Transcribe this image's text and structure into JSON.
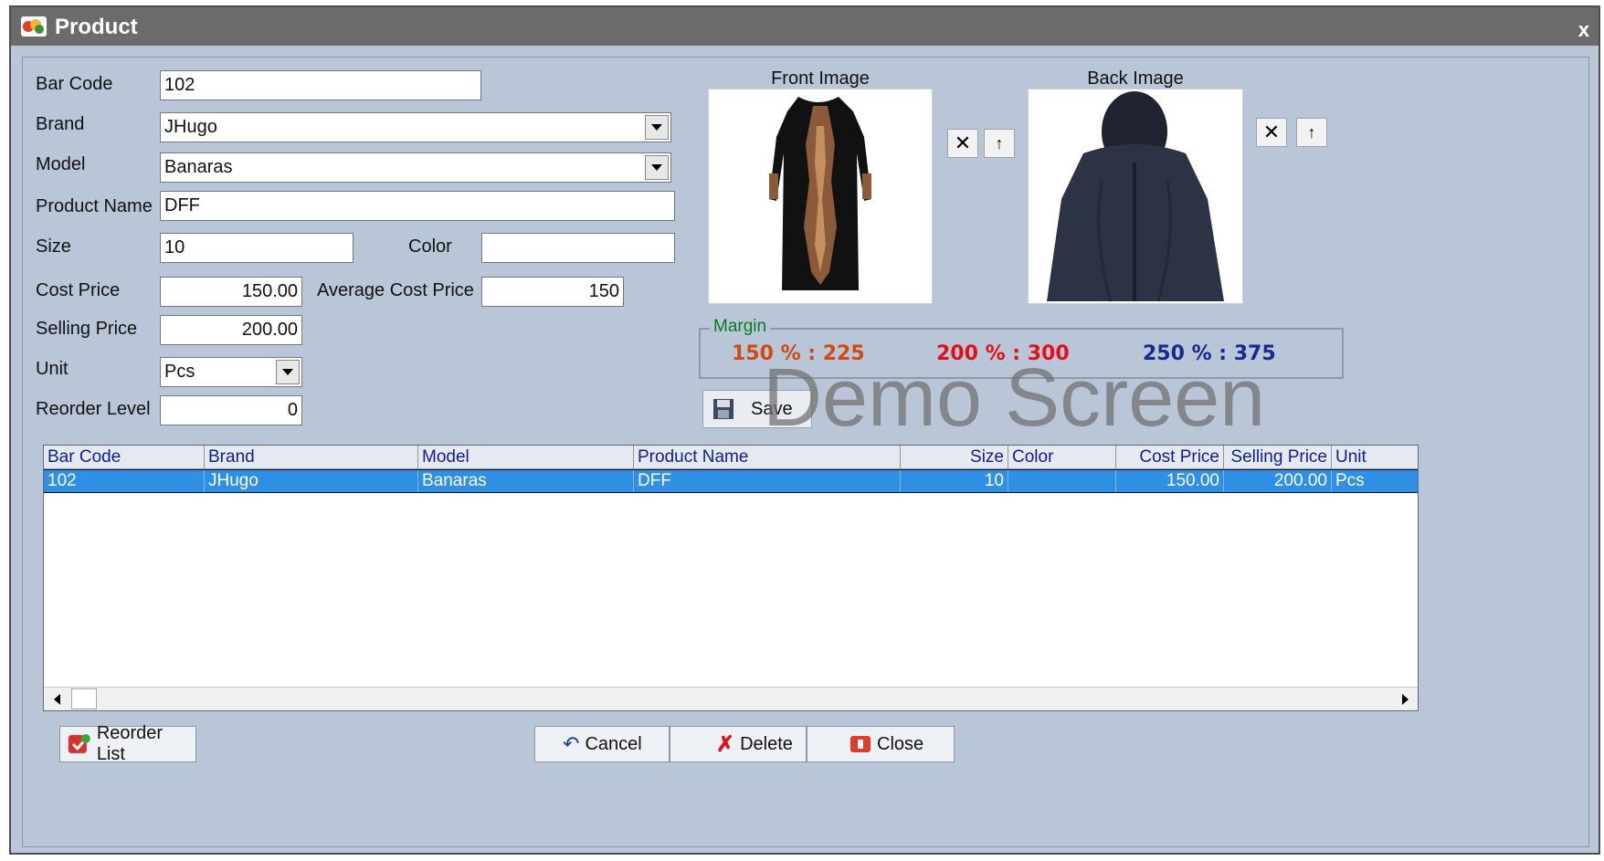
{
  "window": {
    "title": "Product",
    "close_label": "x"
  },
  "form": {
    "bar_code": {
      "label": "Bar Code",
      "value": "102"
    },
    "brand": {
      "label": "Brand",
      "value": "JHugo"
    },
    "model": {
      "label": "Model",
      "value": "Banaras"
    },
    "product_name": {
      "label": "Product Name",
      "value": "DFF"
    },
    "size": {
      "label": "Size",
      "value": "10"
    },
    "color": {
      "label": "Color",
      "value": ""
    },
    "cost_price": {
      "label": "Cost Price",
      "value": "150.00"
    },
    "average_cost_price": {
      "label": "Average Cost Price",
      "value": "150"
    },
    "selling_price": {
      "label": "Selling Price",
      "value": "200.00"
    },
    "unit": {
      "label": "Unit",
      "value": "Pcs"
    },
    "reorder_level": {
      "label": "Reorder Level",
      "value": "0"
    }
  },
  "images": {
    "front": {
      "caption": "Front Image"
    },
    "back": {
      "caption": "Back Image"
    }
  },
  "margin": {
    "legend": "Margin",
    "values": [
      {
        "text": "150 % : 225",
        "color": "#d24a12"
      },
      {
        "text": "200 % : 300",
        "color": "#e0101a"
      },
      {
        "text": "250 % : 375",
        "color": "#1a2a8c"
      }
    ]
  },
  "save_button": {
    "label": "Save"
  },
  "watermark": "Demo Screen",
  "grid": {
    "columns": [
      "Bar Code",
      "Brand",
      "Model",
      "Product Name",
      "Size",
      "Color",
      "Cost Price",
      "Selling Price",
      "Unit"
    ],
    "rows": [
      [
        "102",
        "JHugo",
        "Banaras",
        "DFF",
        "10",
        "",
        "150.00",
        "200.00",
        "Pcs"
      ]
    ]
  },
  "buttons": {
    "reorder_list": "Reorder List",
    "cancel": "Cancel",
    "delete": "Delete",
    "close": "Close"
  },
  "colors": {
    "title_bar": "#6b6b6b",
    "form_bg": "#b9c6d7",
    "row_highlight": "#2f8fe4",
    "header_text": "#0e1e96"
  },
  "icons": [
    "app-icon",
    "remove-image-icon",
    "upload-image-icon",
    "save-disk-icon",
    "reorder-list-icon",
    "undo-icon",
    "delete-x-icon",
    "close-icon"
  ]
}
